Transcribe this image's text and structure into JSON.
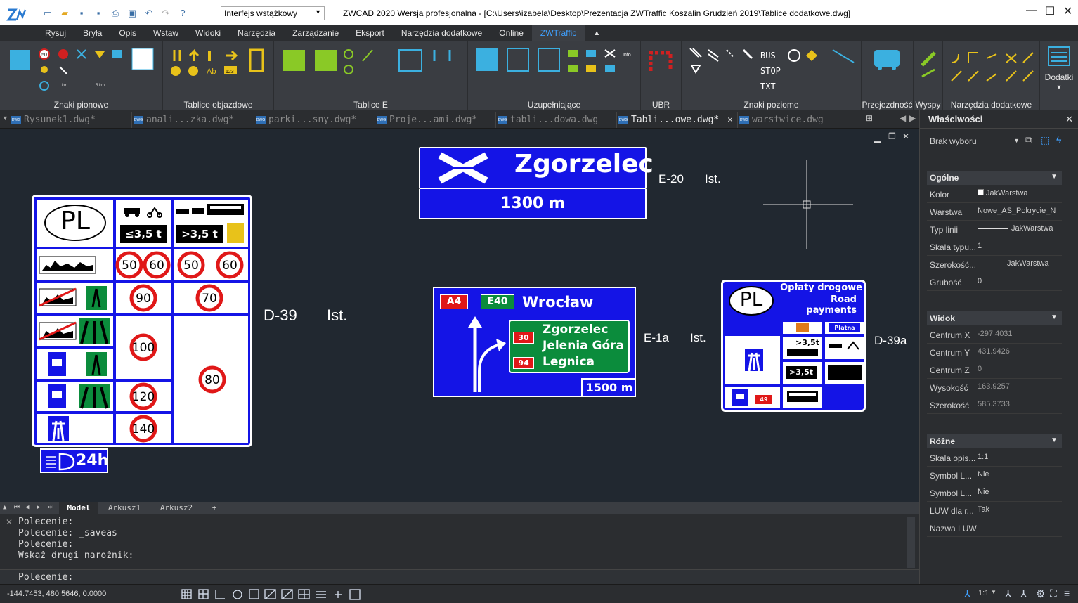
{
  "app": {
    "title": "ZWCAD 2020 Wersja profesjonalna - [C:\\Users\\izabela\\Desktop\\Prezentacja ZWTraffic Koszalin Grudzień 2019\\Tablice dodatkowe.dwg]",
    "workspace": "Interfejs wstążkowy"
  },
  "menu": [
    "Rysuj",
    "Bryła",
    "Opis",
    "Wstaw",
    "Widoki",
    "Narzędzia",
    "Zarządzanie",
    "Eksport",
    "Narzędzia dodatkowe",
    "Online",
    "ZWTraffic"
  ],
  "ribbon_groups": [
    "Znaki pionowe",
    "Tablice objazdowe",
    "Tablice E",
    "Uzupełniające",
    "UBR",
    "Znaki poziome",
    "Przejezdność",
    "Wyspy",
    "Narzędzia dodatkowe",
    "Dodatki"
  ],
  "ribbon_text": {
    "bus": "BUS",
    "stop": "STOP",
    "txt": "TXT",
    "info": "Info",
    "ab": "Ab",
    "n123": "123",
    "s50": "50",
    "km": "km",
    "km2": "5 km"
  },
  "doc_tabs": [
    "Rysunek1.dwg*",
    "anali...zka.dwg*",
    "parki...sny.dwg*",
    "Proje...ami.dwg*",
    "tabli...dowa.dwg",
    "Tabli...owe.dwg*",
    "warstwice.dwg"
  ],
  "dwg_tag": "DWG",
  "active_tab": 5,
  "drawing": {
    "e20": {
      "city": "Zgorzelec",
      "distance": "1300 m",
      "code": "E-20",
      "ist": "Ist."
    },
    "e1a": {
      "road1": "A4",
      "road2": "E40",
      "city_top": "Wrocław",
      "routes": [
        {
          "num": "30",
          "city": "Zgorzelec"
        },
        {
          "num": "",
          "city": "Jelenia Góra"
        },
        {
          "num": "94",
          "city": "Legnica"
        }
      ],
      "distance": "1500 m",
      "code": "E-1a",
      "ist": "Ist."
    },
    "d39": {
      "country": "PL",
      "code": "D-39",
      "ist": "Ist.",
      "w1": "≤3,5 t",
      "w2": ">3,5 t",
      "speeds": [
        "50",
        "60",
        "50",
        "60",
        "90",
        "70",
        "100",
        "80",
        "120",
        "140"
      ],
      "lights": "24h"
    },
    "d39a": {
      "country": "PL",
      "title1": "Opłaty drogowe",
      "title2": "Road payments",
      "paid": "Płatna",
      "w1": ">3,5t",
      "w2": ">3,5t",
      "route": "49",
      "code": "D-39a"
    }
  },
  "sheets": [
    "Model",
    "Arkusz1",
    "Arkusz2",
    "+"
  ],
  "command": {
    "lines": [
      "Polecenie:",
      "Polecenie: _saveas",
      "Polecenie:",
      "Wskaż drugi narożnik:"
    ],
    "prompt": "Polecenie:"
  },
  "status": {
    "coords": "-144.7453, 480.5646, 0.0000",
    "scale": "1:1"
  },
  "properties": {
    "title": "Właściwości",
    "selection": "Brak wyboru",
    "sections": {
      "general": "Ogólne",
      "view": "Widok",
      "misc": "Różne"
    },
    "general": [
      [
        "Kolor",
        "JakWarstwa"
      ],
      [
        "Warstwa",
        "Nowe_AS_Pokrycie_N"
      ],
      [
        "Typ linii",
        "JakWarstwa"
      ],
      [
        "Skala typu...",
        "1"
      ],
      [
        "Szerokość...",
        "JakWarstwa"
      ],
      [
        "Grubość",
        "0"
      ]
    ],
    "view": [
      [
        "Centrum X",
        "-297.4031"
      ],
      [
        "Centrum Y",
        "431.9426"
      ],
      [
        "Centrum Z",
        "0"
      ],
      [
        "Wysokość",
        "163.9257"
      ],
      [
        "Szerokość",
        "585.3733"
      ]
    ],
    "misc": [
      [
        "Skala opis...",
        "1:1"
      ],
      [
        "Symbol L...",
        "Nie"
      ],
      [
        "Symbol L...",
        "Nie"
      ],
      [
        "LUW dla r...",
        "Tak"
      ],
      [
        "Nazwa LUW",
        ""
      ]
    ]
  },
  "colors": {
    "accent": "#3fa0ff",
    "sign_blue": "#1414e6",
    "sign_green": "#0b8c3c",
    "sign_red": "#e01818",
    "ribbon_icon": "#e8c21a",
    "ribbon_cyan": "#3bb0e0"
  }
}
